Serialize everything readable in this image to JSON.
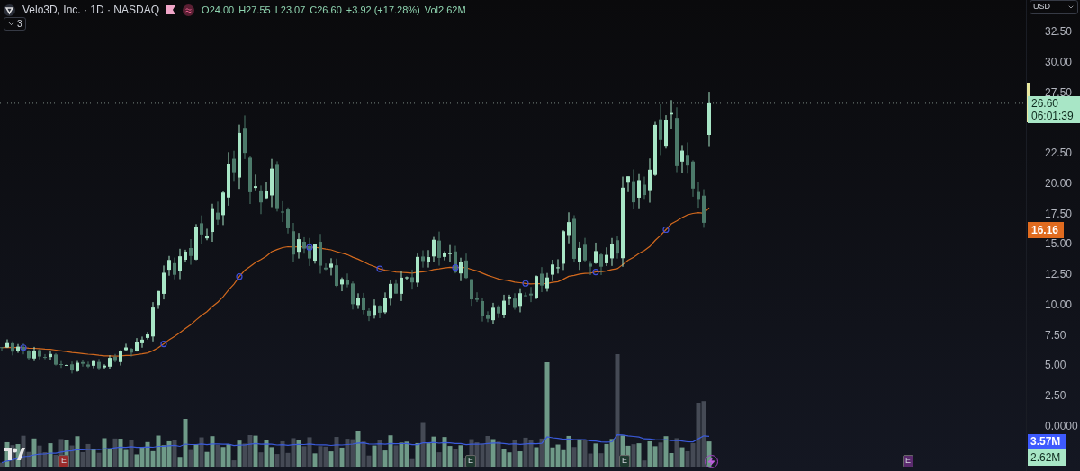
{
  "legend": {
    "title": "Velo3D, Inc. · 1D · NASDAQ",
    "values": [
      {
        "label": "O",
        "value": "24.00"
      },
      {
        "label": "H",
        "value": "27.55"
      },
      {
        "label": "L",
        "value": "23.07"
      },
      {
        "label": "C",
        "value": "26.60"
      },
      {
        "value": "+3.92 (+17.28%)"
      },
      {
        "label": "Vol",
        "value": "2.62M"
      }
    ],
    "indicator_count": "3"
  },
  "currency": "USD",
  "price_axis": {
    "ticks": [
      "32.50",
      "30.00",
      "27.50",
      "22.50",
      "20.00",
      "17.50",
      "15.00",
      "12.50",
      "10.00",
      "7.50",
      "5.00",
      "2.50",
      "0.0000"
    ]
  },
  "labels": {
    "last_price": "26.60",
    "countdown": "06:01:39",
    "moving_average": "16.16",
    "volume_average": "3.57M",
    "volume": "2.62M"
  },
  "events": [
    {
      "label": "E",
      "color": "#9b2c2c"
    },
    {
      "label": "E",
      "color": "#1f3a30"
    },
    {
      "label": "E",
      "color": "#1f3a30"
    },
    {
      "label": "E",
      "color": "#5b2a6e"
    }
  ]
}
